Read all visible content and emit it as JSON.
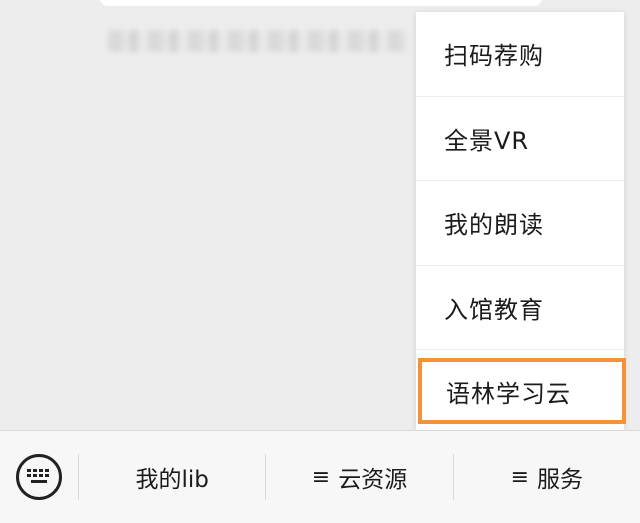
{
  "popup_menu": {
    "items": [
      {
        "label": "扫码荐购"
      },
      {
        "label": "全景VR"
      },
      {
        "label": "我的朗读"
      },
      {
        "label": "入馆教育"
      },
      {
        "label": "语林学习云"
      }
    ],
    "highlight_color": "#f2923a"
  },
  "bottom_bar": {
    "keyboard_icon": "keyboard-icon",
    "tabs": [
      {
        "label": "我的lib",
        "prefix": ""
      },
      {
        "label": "云资源",
        "prefix": "≡"
      },
      {
        "label": "服务",
        "prefix": "≡"
      }
    ]
  }
}
